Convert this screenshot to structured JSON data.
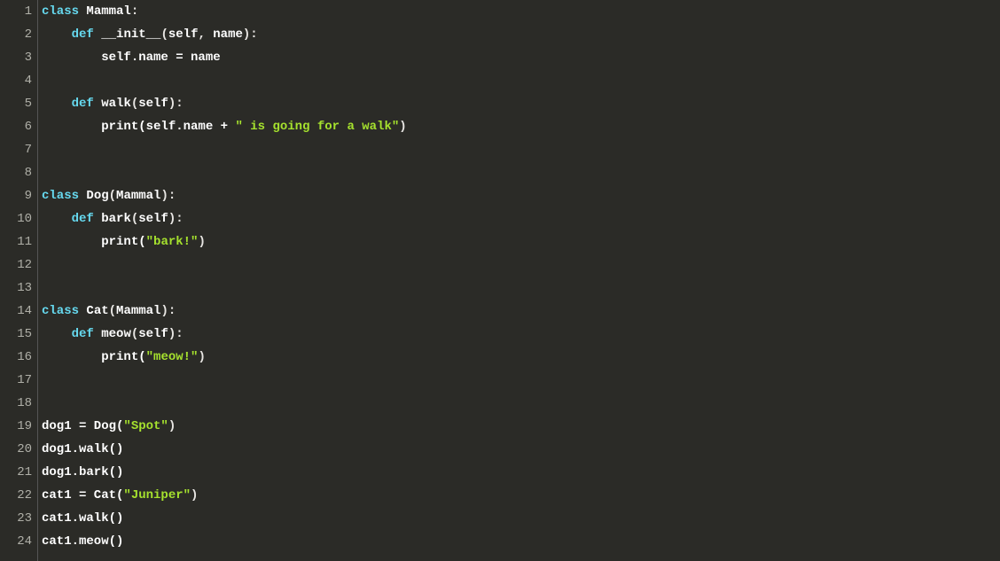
{
  "lineNumbers": [
    "1",
    "2",
    "3",
    "4",
    "5",
    "6",
    "7",
    "8",
    "9",
    "10",
    "11",
    "12",
    "13",
    "14",
    "15",
    "16",
    "17",
    "18",
    "19",
    "20",
    "21",
    "22",
    "23",
    "24"
  ],
  "code": {
    "l1": {
      "kw1": "class",
      "sp1": " ",
      "name": "Mammal",
      "colon": ":"
    },
    "l2": {
      "indent": "    ",
      "kw": "def",
      "sp": " ",
      "fn": "__init__",
      "open": "(",
      "arg1": "self",
      "comma": ", ",
      "arg2": "name",
      "close": "):"
    },
    "l3": {
      "indent": "        ",
      "selfname": "self.name = name"
    },
    "l4": {
      "blank": ""
    },
    "l5": {
      "indent": "    ",
      "kw": "def",
      "sp": " ",
      "fn": "walk",
      "open": "(",
      "arg": "self",
      "close": "):"
    },
    "l6": {
      "indent": "        ",
      "call": "print(self.name + ",
      "str": "\" is going for a walk\"",
      "end": ")"
    },
    "l7": {
      "blank": ""
    },
    "l8": {
      "blank": ""
    },
    "l9": {
      "kw": "class",
      "sp": " ",
      "name": "Dog",
      "open": "(",
      "base": "Mammal",
      "close": "):"
    },
    "l10": {
      "indent": "    ",
      "kw": "def",
      "sp": " ",
      "fn": "bark",
      "open": "(",
      "arg": "self",
      "close": "):"
    },
    "l11": {
      "indent": "        ",
      "call": "print(",
      "str": "\"bark!\"",
      "end": ")"
    },
    "l12": {
      "blank": ""
    },
    "l13": {
      "blank": ""
    },
    "l14": {
      "kw": "class",
      "sp": " ",
      "name": "Cat",
      "open": "(",
      "base": "Mammal",
      "close": "):"
    },
    "l15": {
      "indent": "    ",
      "kw": "def",
      "sp": " ",
      "fn": "meow",
      "open": "(",
      "arg": "self",
      "close": "):"
    },
    "l16": {
      "indent": "        ",
      "call": "print(",
      "str": "\"meow!\"",
      "end": ")"
    },
    "l17": {
      "blank": ""
    },
    "l18": {
      "blank": ""
    },
    "l19": {
      "text1": "dog1 = Dog(",
      "str": "\"Spot\"",
      "text2": ")"
    },
    "l20": {
      "text": "dog1.walk()"
    },
    "l21": {
      "text": "dog1.bark()"
    },
    "l22": {
      "text1": "cat1 = Cat(",
      "str": "\"Juniper\"",
      "text2": ")"
    },
    "l23": {
      "text": "cat1.walk()"
    },
    "l24": {
      "text": "cat1.meow()"
    }
  }
}
